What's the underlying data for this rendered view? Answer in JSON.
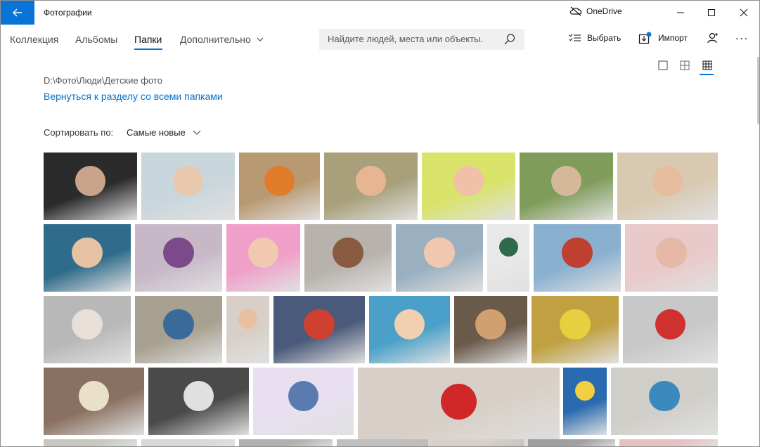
{
  "titlebar": {
    "app_title": "Фотографии",
    "onedrive_label": "OneDrive"
  },
  "nav": {
    "tabs": [
      "Коллекция",
      "Альбомы",
      "Папки",
      "Дополнительно"
    ],
    "active_tab": "Папки",
    "search_placeholder": "Найдите людей, места или объекты.",
    "select_label": "Выбрать",
    "import_label": "Импорт",
    "more_label": "..."
  },
  "folder": {
    "path": "D:\\Фото\\Люди\\Детские фото",
    "back_link": "Вернуться к разделу со всеми папками"
  },
  "sort": {
    "label": "Сортировать по:",
    "value": "Самые новые"
  },
  "colors": {
    "accent": "#0a74d6",
    "link": "#0a6fc2"
  },
  "icons": [
    "back-arrow-icon",
    "onedrive-icon",
    "minimize-icon",
    "maximize-icon",
    "close-icon",
    "chevron-down-icon",
    "search-icon",
    "select-list-icon",
    "import-icon",
    "person-add-icon",
    "single-view-icon",
    "medium-grid-icon",
    "small-grid-icon"
  ]
}
